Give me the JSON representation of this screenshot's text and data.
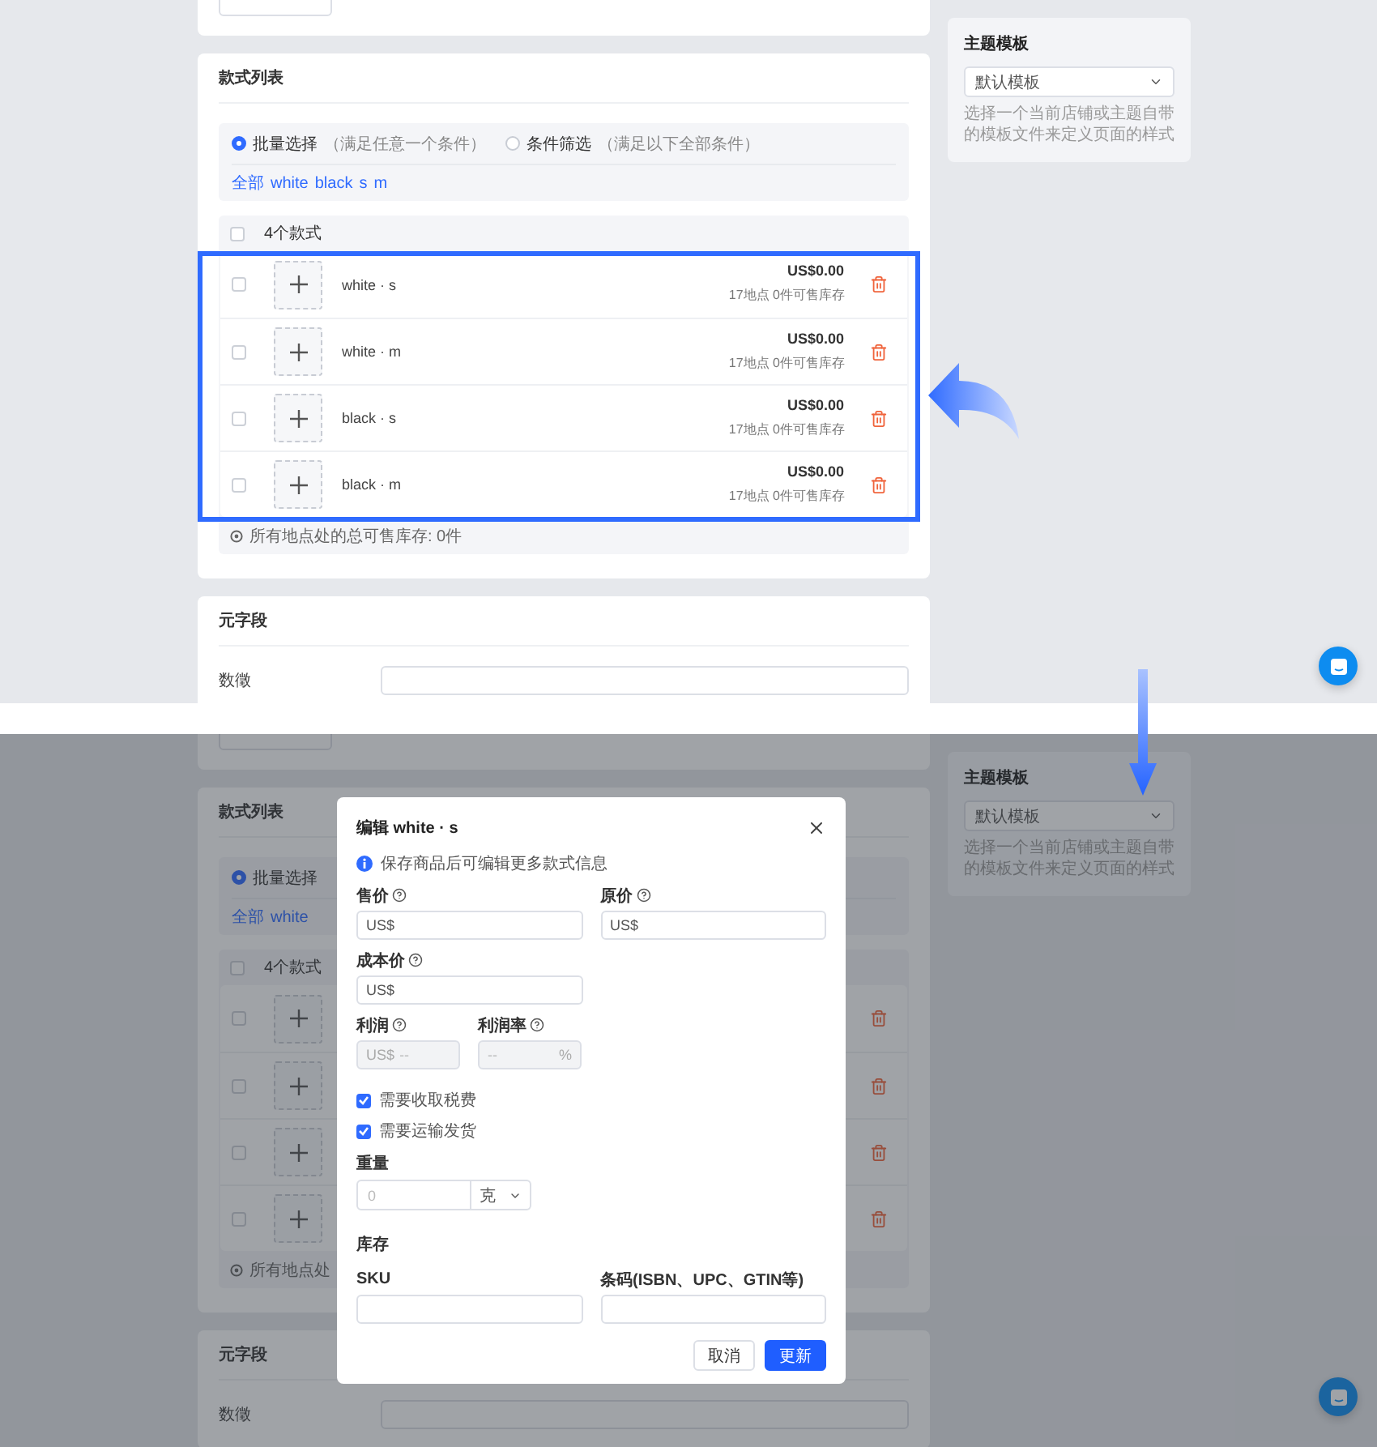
{
  "top_screen": {
    "variants_card": {
      "title": "款式列表",
      "filter_modes": [
        {
          "label": "批量选择",
          "hint": "（满足任意一个条件）",
          "selected": true
        },
        {
          "label": "条件筛选",
          "hint": "（满足以下全部条件）",
          "selected": false
        }
      ],
      "tags": [
        "全部",
        "white",
        "black",
        "s",
        "m"
      ],
      "header": {
        "label": "4个款式",
        "checked": false
      },
      "rows": [
        {
          "name": "white · s",
          "price": "US$0.00",
          "stock": "17地点 0件可售库存",
          "checked": false
        },
        {
          "name": "white · m",
          "price": "US$0.00",
          "stock": "17地点 0件可售库存",
          "checked": false
        },
        {
          "name": "black · s",
          "price": "US$0.00",
          "stock": "17地点 0件可售库存",
          "checked": false
        },
        {
          "name": "black · m",
          "price": "US$0.00",
          "stock": "17地点 0件可售库存",
          "checked": false
        }
      ],
      "total": "所有地点处的总可售库存: 0件"
    },
    "meta_card": {
      "title": "元字段",
      "fields": [
        {
          "label": "数徵"
        }
      ]
    },
    "template_card": {
      "title": "主题模板",
      "select": "默认模板",
      "help": "选择一个当前店铺或主题自带的模板文件来定义页面的样式"
    }
  },
  "bottom_screen": {
    "variants_card": {
      "title": "款式列表",
      "filter_modes": [
        {
          "label": "批量选择",
          "selected": true
        }
      ],
      "tags": [
        "全部",
        "white"
      ],
      "header": {
        "label": "4个款式",
        "checked": false
      },
      "rows": [
        {
          "checked": false
        },
        {
          "checked": false
        },
        {
          "checked": false
        },
        {
          "checked": false
        }
      ],
      "total": "所有地点处"
    },
    "meta_card": {
      "title": "元字段",
      "fields": [
        {
          "label": "数徵"
        }
      ]
    },
    "template_card": {
      "title": "主题模板",
      "select": "默认模板",
      "help": "选择一个当前店铺或主题自带的模板文件来定义页面的样式"
    },
    "modal": {
      "title": "编辑 white · s",
      "notice": "保存商品后可编辑更多款式信息",
      "price_fields": [
        {
          "label": "售价",
          "prefix": "US$"
        },
        {
          "label": "原价",
          "prefix": "US$"
        }
      ],
      "cost_field": {
        "label": "成本价",
        "prefix": "US$"
      },
      "profit_fields": [
        {
          "label": "利润",
          "prefix": "US$",
          "placeholder": "--",
          "disabled": true
        },
        {
          "label": "利润率",
          "placeholder": "--",
          "suffix": "%",
          "disabled": true
        }
      ],
      "checkboxes": [
        {
          "label": "需要收取税费",
          "checked": true
        },
        {
          "label": "需要运输发货",
          "checked": true
        }
      ],
      "weight": {
        "label": "重量",
        "placeholder": "0",
        "unit": "克"
      },
      "inventory": {
        "title": "库存",
        "fields": [
          {
            "label": "SKU"
          },
          {
            "label": "条码(ISBN、UPC、GTIN等)"
          }
        ]
      },
      "buttons": [
        {
          "label": "取消",
          "kind": "secondary"
        },
        {
          "label": "更新",
          "kind": "primary"
        }
      ]
    }
  }
}
